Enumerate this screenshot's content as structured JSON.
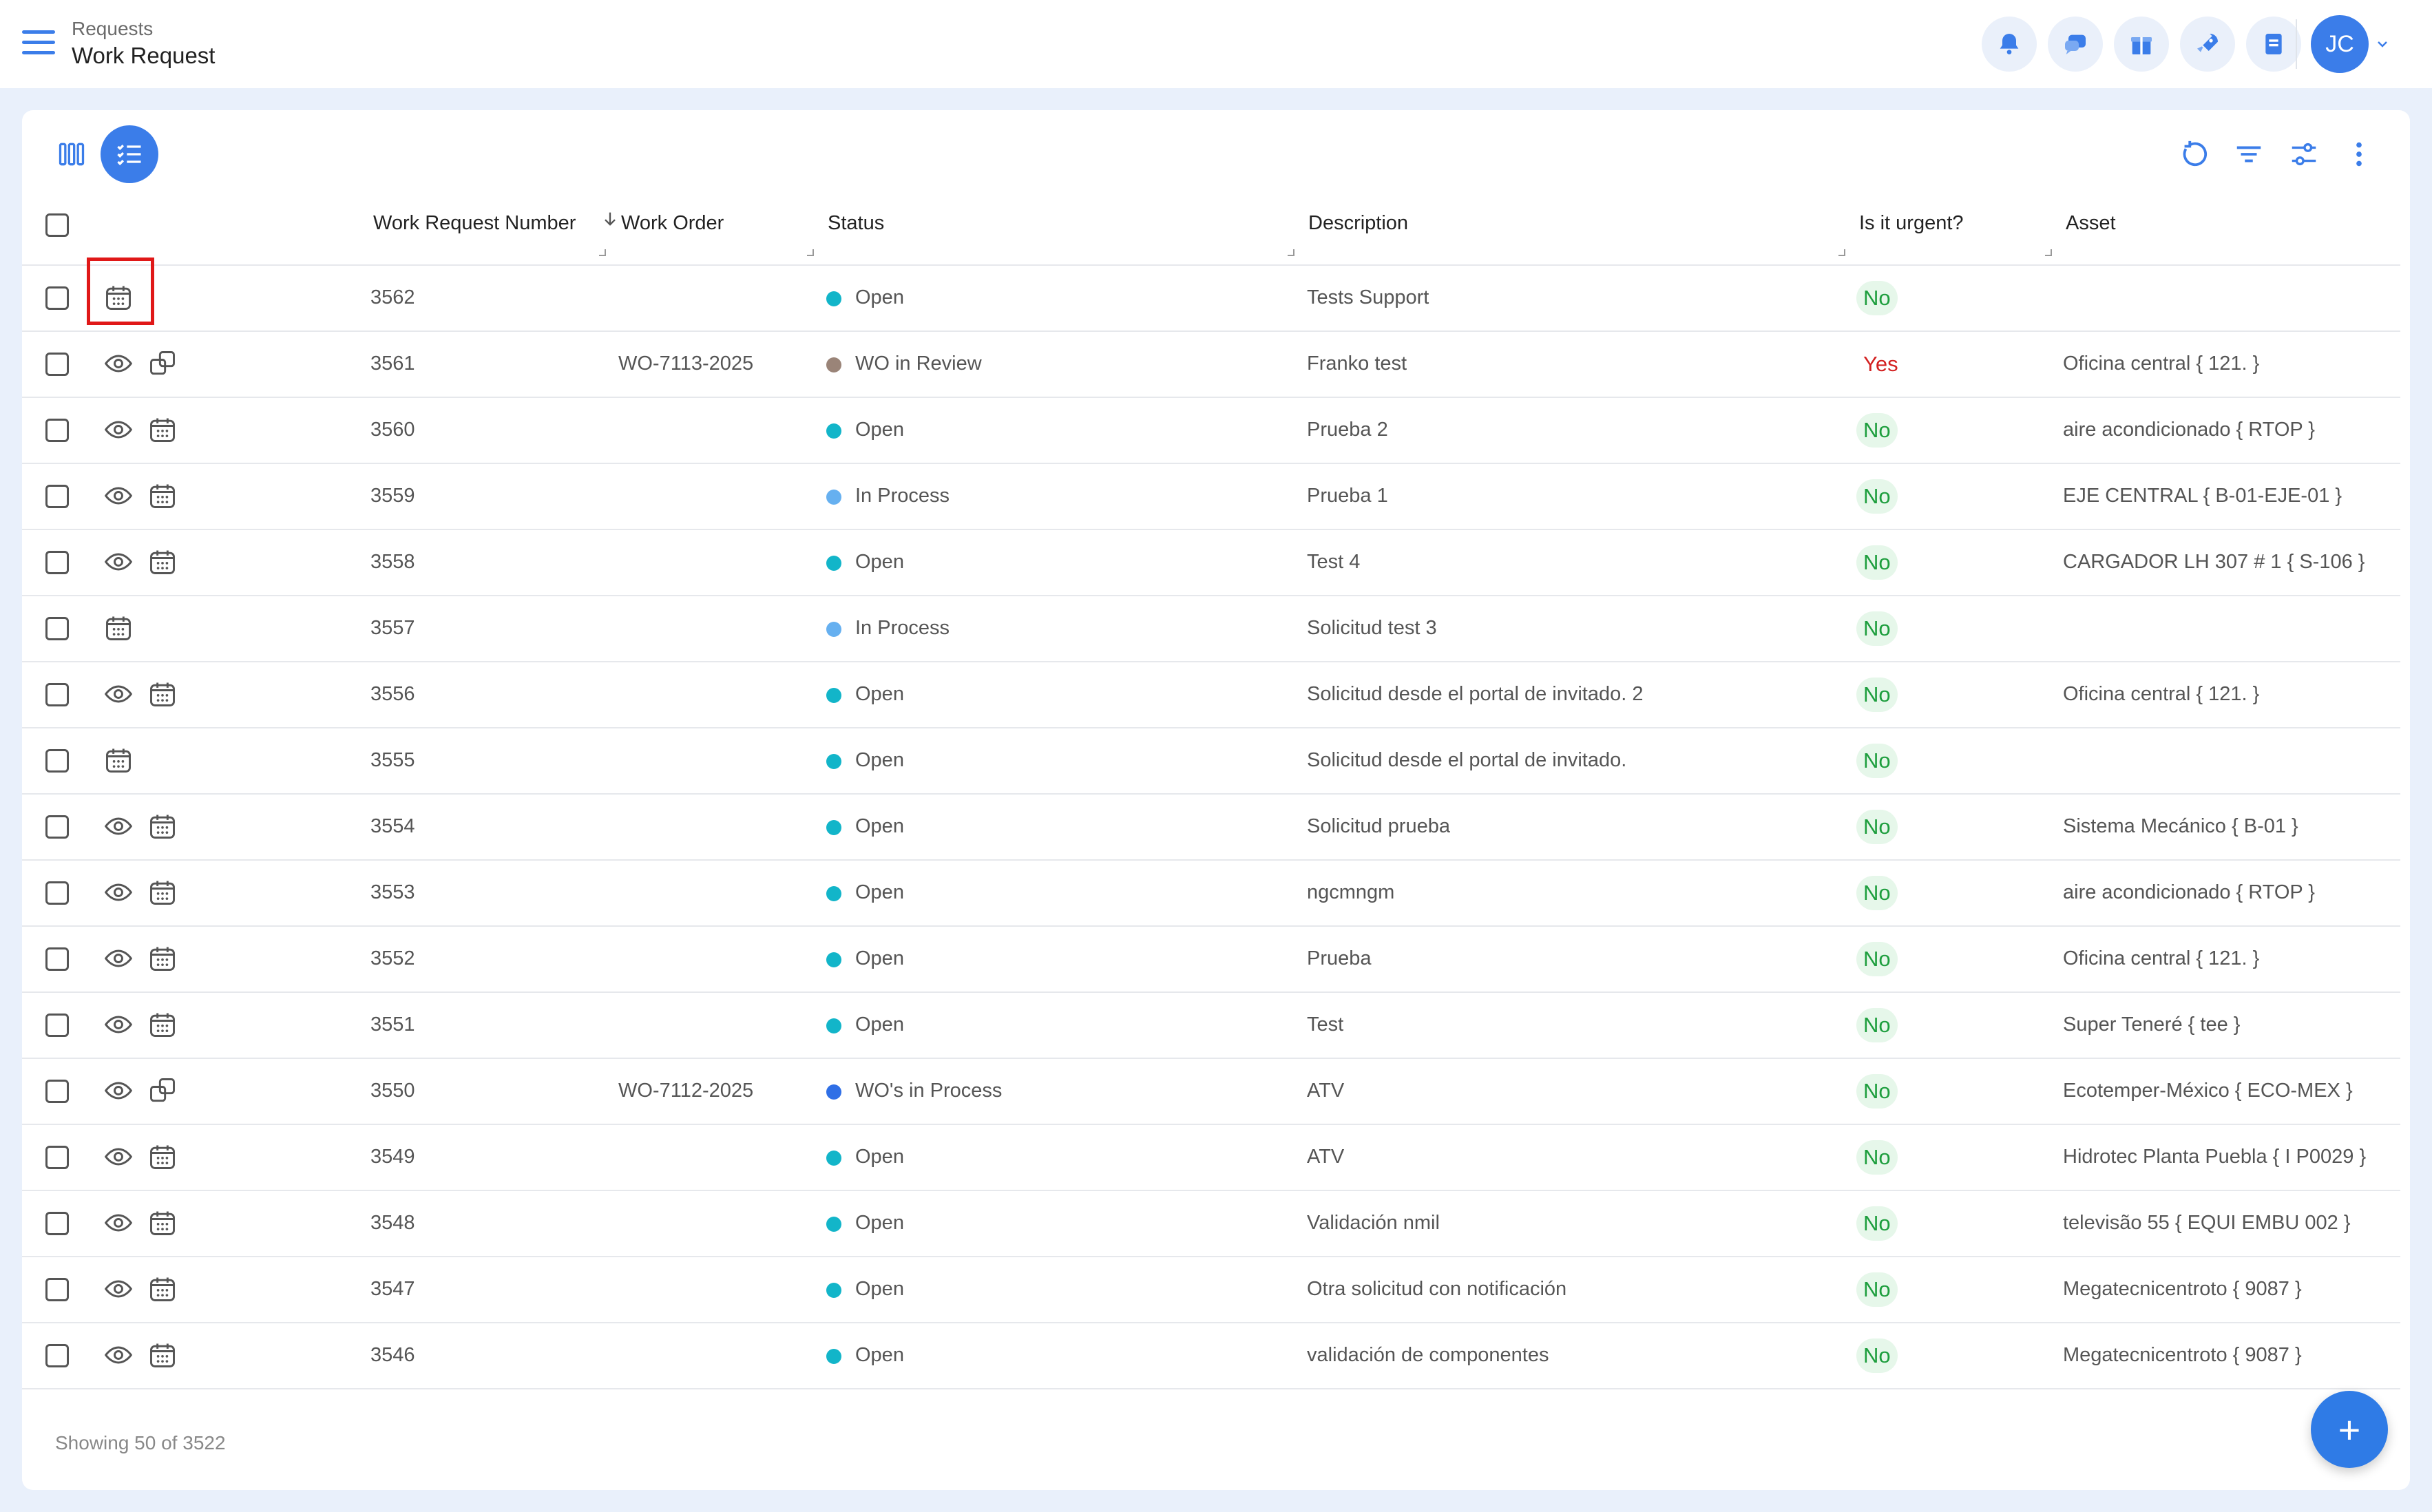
{
  "breadcrumb": {
    "parent": "Requests",
    "title": "Work Request"
  },
  "user": {
    "initials": "JC"
  },
  "top_icons": [
    "bell-icon",
    "chat-icon",
    "gift-icon",
    "rocket-icon",
    "notes-icon"
  ],
  "colors": {
    "accent": "#3b7de9",
    "open": "#12b5c9",
    "in_review": "#9a8478",
    "in_process": "#66b0f0",
    "wos_in_process": "#2f6fe6",
    "urgent_no": "#1e9e3e",
    "urgent_yes": "#d32020"
  },
  "columns": {
    "number": "Work Request Number",
    "work_order": "Work Order",
    "status": "Status",
    "description": "Description",
    "urgent": "Is it urgent?",
    "asset": "Asset"
  },
  "rows": [
    {
      "number": "3562",
      "work_order": "",
      "status": "Open",
      "description": "Tests Support",
      "urgent": "No",
      "asset": "",
      "icons": [
        "calendar-icon"
      ]
    },
    {
      "number": "3561",
      "work_order": "WO-7113-2025",
      "status": "WO in Review",
      "description": "Franko test",
      "urgent": "Yes",
      "asset": "Oficina central { 121. }",
      "icons": [
        "eye-icon",
        "copy-icon"
      ]
    },
    {
      "number": "3560",
      "work_order": "",
      "status": "Open",
      "description": "Prueba 2",
      "urgent": "No",
      "asset": "aire acondicionado { RTOP }",
      "icons": [
        "eye-icon",
        "calendar-icon"
      ]
    },
    {
      "number": "3559",
      "work_order": "",
      "status": "In Process",
      "description": "Prueba 1",
      "urgent": "No",
      "asset": "EJE CENTRAL { B-01-EJE-01 }",
      "icons": [
        "eye-icon",
        "calendar-icon"
      ]
    },
    {
      "number": "3558",
      "work_order": "",
      "status": "Open",
      "description": "Test 4",
      "urgent": "No",
      "asset": "CARGADOR LH 307 # 1 { S-106 }",
      "icons": [
        "eye-icon",
        "calendar-icon"
      ]
    },
    {
      "number": "3557",
      "work_order": "",
      "status": "In Process",
      "description": "Solicitud test 3",
      "urgent": "No",
      "asset": "",
      "icons": [
        "calendar-icon"
      ]
    },
    {
      "number": "3556",
      "work_order": "",
      "status": "Open",
      "description": "Solicitud desde el portal de invitado. 2",
      "urgent": "No",
      "asset": "Oficina central { 121. }",
      "icons": [
        "eye-icon",
        "calendar-icon"
      ]
    },
    {
      "number": "3555",
      "work_order": "",
      "status": "Open",
      "description": "Solicitud desde el portal de invitado.",
      "urgent": "No",
      "asset": "",
      "icons": [
        "calendar-icon"
      ]
    },
    {
      "number": "3554",
      "work_order": "",
      "status": "Open",
      "description": "Solicitud prueba",
      "urgent": "No",
      "asset": "Sistema Mecánico { B-01 }",
      "icons": [
        "eye-icon",
        "calendar-icon"
      ]
    },
    {
      "number": "3553",
      "work_order": "",
      "status": "Open",
      "description": "ngcmngm",
      "urgent": "No",
      "asset": "aire acondicionado { RTOP }",
      "icons": [
        "eye-icon",
        "calendar-icon"
      ]
    },
    {
      "number": "3552",
      "work_order": "",
      "status": "Open",
      "description": "Prueba",
      "urgent": "No",
      "asset": "Oficina central { 121. }",
      "icons": [
        "eye-icon",
        "calendar-icon"
      ]
    },
    {
      "number": "3551",
      "work_order": "",
      "status": "Open",
      "description": "Test",
      "urgent": "No",
      "asset": "Super Teneré { tee }",
      "icons": [
        "eye-icon",
        "calendar-icon"
      ]
    },
    {
      "number": "3550",
      "work_order": "WO-7112-2025",
      "status": "WO's in Process",
      "description": "ATV",
      "urgent": "No",
      "asset": "Ecotemper-México { ECO-MEX }",
      "icons": [
        "eye-icon",
        "copy-icon"
      ]
    },
    {
      "number": "3549",
      "work_order": "",
      "status": "Open",
      "description": "ATV",
      "urgent": "No",
      "asset": "Hidrotec Planta Puebla { I P0029 }",
      "icons": [
        "eye-icon",
        "calendar-icon"
      ]
    },
    {
      "number": "3548",
      "work_order": "",
      "status": "Open",
      "description": "Validación nmil",
      "urgent": "No",
      "asset": "televisão 55 { EQUI EMBU 002 }",
      "icons": [
        "eye-icon",
        "calendar-icon"
      ]
    },
    {
      "number": "3547",
      "work_order": "",
      "status": "Open",
      "description": "Otra solicitud con notificación",
      "urgent": "No",
      "asset": "Megatecnicentroto { 9087 }",
      "icons": [
        "eye-icon",
        "calendar-icon"
      ]
    },
    {
      "number": "3546",
      "work_order": "",
      "status": "Open",
      "description": "validación de componentes",
      "urgent": "No",
      "asset": "Megatecnicentroto { 9087 }",
      "icons": [
        "eye-icon",
        "calendar-icon"
      ]
    }
  ],
  "footer": {
    "showing": "Showing 50 of 3522"
  },
  "fab": {
    "label": "+"
  }
}
